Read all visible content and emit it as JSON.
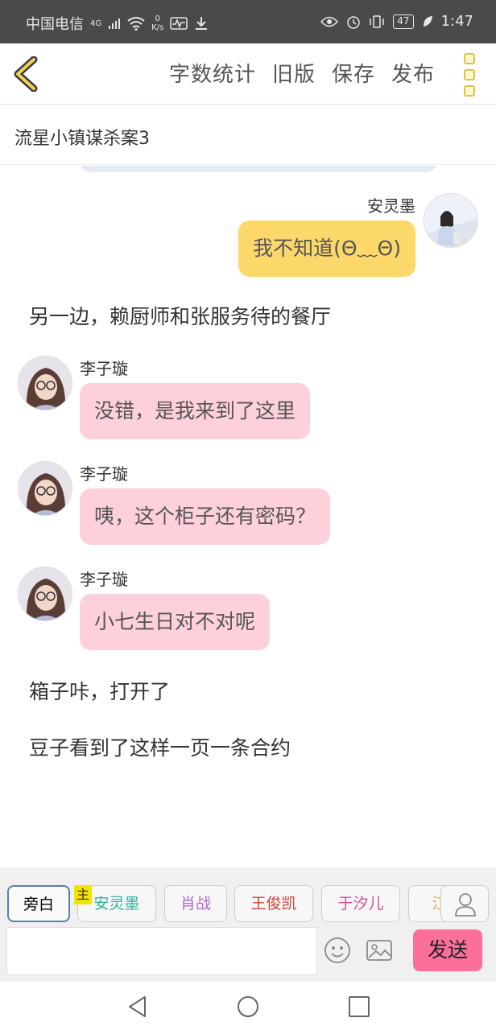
{
  "status_bar": {
    "carrier": "中国电信",
    "network": "4G",
    "speed_value": "0",
    "speed_unit": "K/s",
    "battery": "47",
    "time": "1:47"
  },
  "toolbar": {
    "word_count": "字数统计",
    "old_version": "旧版",
    "save": "保存",
    "publish": "发布"
  },
  "story_title": "流星小镇谋杀案3",
  "messages": [
    {
      "type": "right",
      "name": "安灵墨",
      "text": "我不知道(Θ﹏Θ)"
    },
    {
      "type": "narration",
      "text": "另一边，赖厨师和张服务待的餐厅"
    },
    {
      "type": "left",
      "name": "李子璇",
      "text": "没错，是我来到了这里"
    },
    {
      "type": "left",
      "name": "李子璇",
      "text": "咦，这个柜子还有密码？"
    },
    {
      "type": "left",
      "name": "李子璇",
      "text": "小七生日对不对呢"
    },
    {
      "type": "narration",
      "text": "箱子咔，打开了"
    },
    {
      "type": "narration",
      "text": "豆子看到了这样一页一条合约"
    }
  ],
  "characters": [
    {
      "label": "旁白",
      "color": "#555555"
    },
    {
      "label": "安灵墨",
      "color": "#2bb3a3"
    },
    {
      "label": "肖战",
      "color": "#b46ad6"
    },
    {
      "label": "王俊凯",
      "color": "#d0453b"
    },
    {
      "label": "于汐儿",
      "color": "#d84a96"
    },
    {
      "label": "江",
      "color": "#e8a14a"
    }
  ],
  "main_badge": "主",
  "send_label": "发送",
  "colors": {
    "accent_yellow": "#fcd86a",
    "accent_pink": "#fdd0da",
    "send_button": "#fd6f9b"
  }
}
